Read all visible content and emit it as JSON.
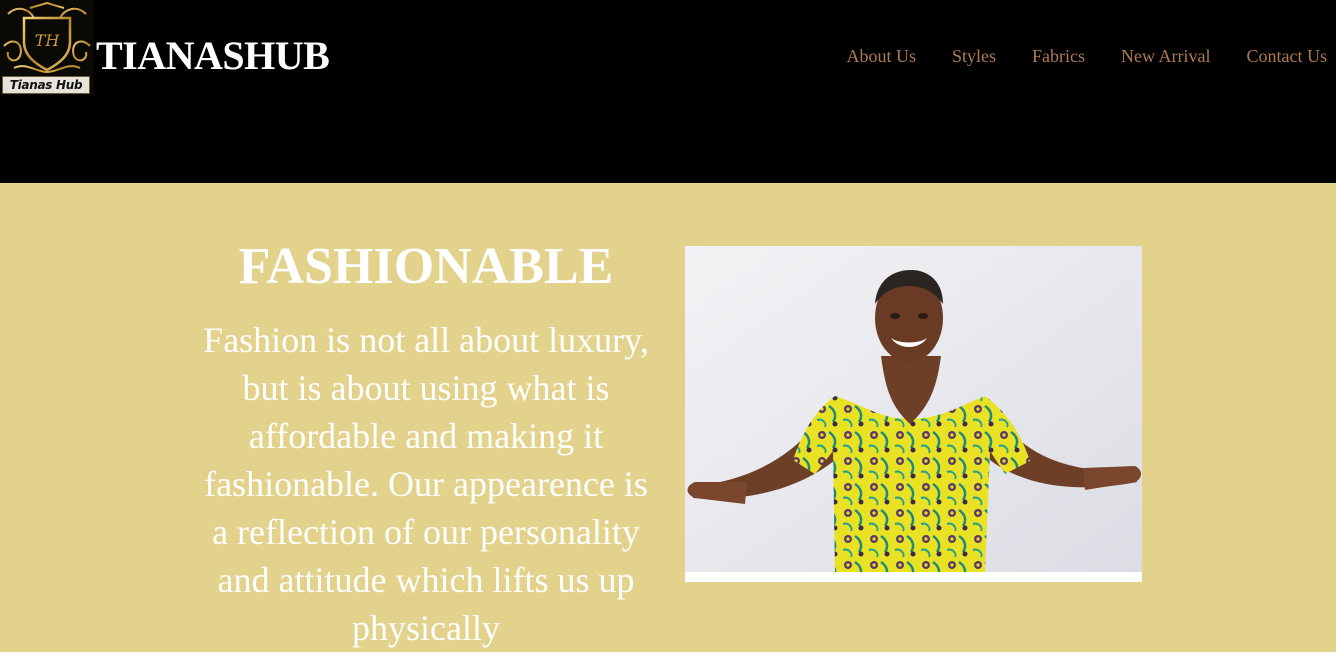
{
  "header": {
    "logo_text": "Tianas Hub",
    "logo_monogram": "TH",
    "brand": "TIANASHUB",
    "nav": [
      {
        "label": "About Us"
      },
      {
        "label": "Styles"
      },
      {
        "label": "Fabrics"
      },
      {
        "label": "New Arrival"
      },
      {
        "label": "Contact Us"
      }
    ]
  },
  "hero": {
    "title": "FASHIONABLE",
    "text": "Fashion is not all about luxury, but is about using what is affordable and making it fashionable. Our appearence is a reflection of our personality and attitude which lifts us up physically"
  },
  "colors": {
    "header_bg": "#000000",
    "page_bg": "#e2d28b",
    "nav_text": "#b07a52",
    "title_text": "#ffffff"
  },
  "photo": {
    "alt": "woman-in-yellow-floral-dress"
  }
}
